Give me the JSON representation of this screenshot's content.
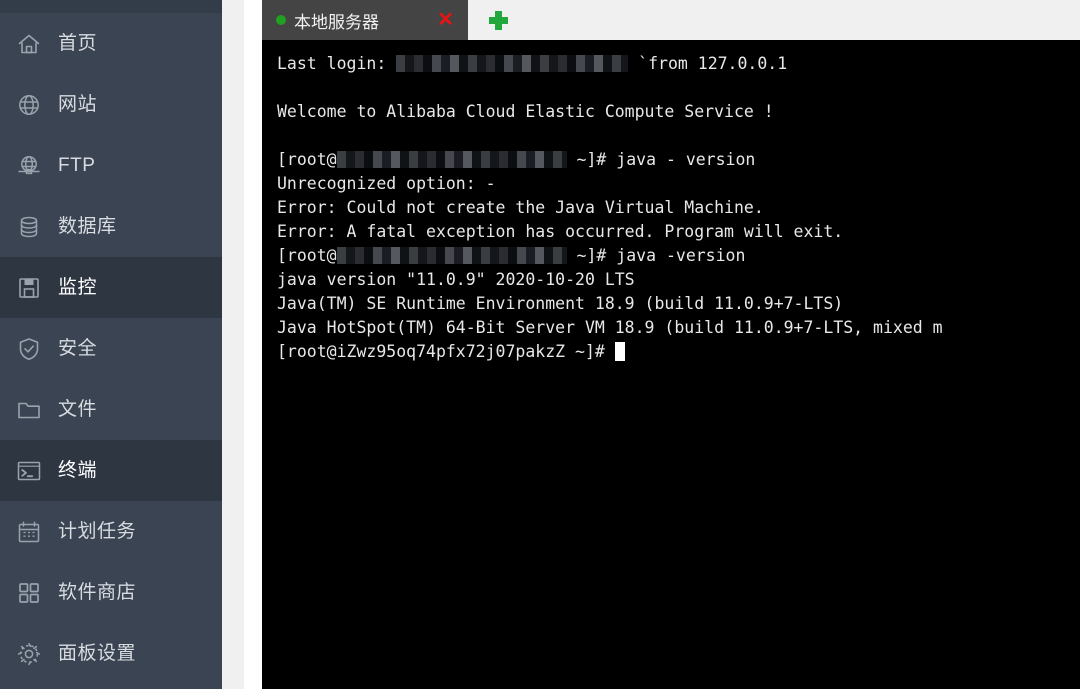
{
  "sidebar": {
    "items": [
      {
        "label": "首页",
        "icon": "home-icon",
        "active": false
      },
      {
        "label": "网站",
        "icon": "globe-icon",
        "active": false
      },
      {
        "label": "FTP",
        "icon": "ftp-icon",
        "active": false
      },
      {
        "label": "数据库",
        "icon": "database-icon",
        "active": false
      },
      {
        "label": "监控",
        "icon": "monitor-icon",
        "active": true
      },
      {
        "label": "安全",
        "icon": "shield-icon",
        "active": false
      },
      {
        "label": "文件",
        "icon": "folder-icon",
        "active": false
      },
      {
        "label": "终端",
        "icon": "terminal-icon",
        "active": true
      },
      {
        "label": "计划任务",
        "icon": "calendar-icon",
        "active": false
      },
      {
        "label": "软件商店",
        "icon": "grid-icon",
        "active": false
      },
      {
        "label": "面板设置",
        "icon": "gear-icon",
        "active": false
      }
    ]
  },
  "tabbar": {
    "active_tab_label": "本地服务器",
    "status_dot_color": "#21a121",
    "close_label": "✕",
    "close_color": "#e81313",
    "add_tab_label": "+",
    "add_tab_color": "#20a83c"
  },
  "terminal": {
    "prompt_host": "[root@iZwz95oq74pfx72j07pakzZ ~]#",
    "lines": [
      {
        "kind": "redacted-login",
        "prefix": "Last login: ",
        "suffix": " `from 127.0.0.1"
      },
      {
        "kind": "blank",
        "text": ""
      },
      {
        "kind": "text",
        "text": "Welcome to Alibaba Cloud Elastic Compute Service !"
      },
      {
        "kind": "blank",
        "text": ""
      },
      {
        "kind": "redacted-prompt",
        "prefix": "[root@",
        "suffix": " ~]# java - version"
      },
      {
        "kind": "text",
        "text": "Unrecognized option: -"
      },
      {
        "kind": "text",
        "text": "Error: Could not create the Java Virtual Machine."
      },
      {
        "kind": "text",
        "text": "Error: A fatal exception has occurred. Program will exit."
      },
      {
        "kind": "redacted-prompt",
        "prefix": "[root@",
        "suffix": " ~]# java -version"
      },
      {
        "kind": "text",
        "text": "java version \"11.0.9\" 2020-10-20 LTS"
      },
      {
        "kind": "text",
        "text": "Java(TM) SE Runtime Environment 18.9 (build 11.0.9+7-LTS)"
      },
      {
        "kind": "text",
        "text": "Java HotSpot(TM) 64-Bit Server VM 18.9 (build 11.0.9+7-LTS, mixed m"
      },
      {
        "kind": "cursor-prompt",
        "text": "[root@iZwz95oq74pfx72j07pakzZ ~]# "
      }
    ]
  },
  "colors": {
    "sidebar_bg": "#3b4452",
    "sidebar_active_bg": "#2e3642",
    "terminal_bg": "#000000",
    "terminal_fg": "#e8e8e8",
    "tabbar_bg": "#f0f0f0",
    "tab_active_bg": "#444444"
  }
}
